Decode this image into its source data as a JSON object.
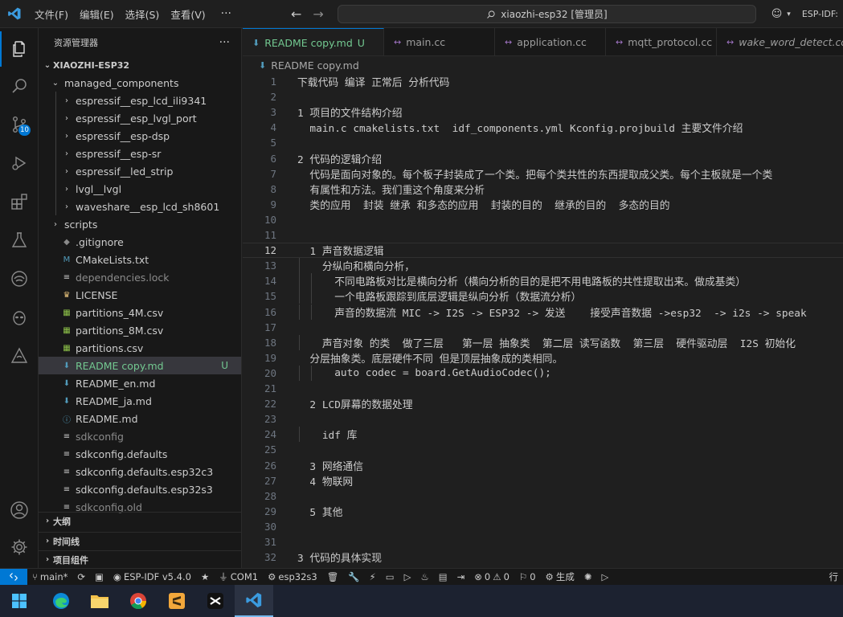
{
  "titlebar": {
    "menus": [
      "文件(F)",
      "编辑(E)",
      "选择(S)",
      "查看(V)"
    ],
    "more": "···",
    "search_text": "xiaozhi-esp32 [管理员]",
    "right_label": "ESP-IDF:"
  },
  "activity": {
    "source_control_badge": "10"
  },
  "sidebar": {
    "title": "资源管理器",
    "more": "···",
    "root": "XIAOZHI-ESP32",
    "tree": [
      {
        "label": "managed_components",
        "kind": "folder-open",
        "indent": 1
      },
      {
        "label": "espressif__esp_lcd_ili9341",
        "kind": "folder",
        "indent": 2
      },
      {
        "label": "espressif__esp_lvgl_port",
        "kind": "folder",
        "indent": 2
      },
      {
        "label": "espressif__esp-dsp",
        "kind": "folder",
        "indent": 2
      },
      {
        "label": "espressif__esp-sr",
        "kind": "folder",
        "indent": 2
      },
      {
        "label": "espressif__led_strip",
        "kind": "folder",
        "indent": 2
      },
      {
        "label": "lvgl__lvgl",
        "kind": "folder",
        "indent": 2
      },
      {
        "label": "waveshare__esp_lcd_sh8601",
        "kind": "folder",
        "indent": 2
      },
      {
        "label": "scripts",
        "kind": "folder",
        "indent": 1
      },
      {
        "label": ".gitignore",
        "kind": "git",
        "indent": 1
      },
      {
        "label": "CMakeLists.txt",
        "kind": "cmake",
        "indent": 1
      },
      {
        "label": "dependencies.lock",
        "kind": "lines",
        "indent": 1,
        "dim": true
      },
      {
        "label": "LICENSE",
        "kind": "license",
        "indent": 1
      },
      {
        "label": "partitions_4M.csv",
        "kind": "csv",
        "indent": 1
      },
      {
        "label": "partitions_8M.csv",
        "kind": "csv",
        "indent": 1
      },
      {
        "label": "partitions.csv",
        "kind": "csv",
        "indent": 1
      },
      {
        "label": "README copy.md",
        "kind": "md",
        "indent": 1,
        "selected": true,
        "status": "U"
      },
      {
        "label": "README_en.md",
        "kind": "md",
        "indent": 1
      },
      {
        "label": "README_ja.md",
        "kind": "md",
        "indent": 1
      },
      {
        "label": "README.md",
        "kind": "info",
        "indent": 1
      },
      {
        "label": "sdkconfig",
        "kind": "lines",
        "indent": 1,
        "dim": true
      },
      {
        "label": "sdkconfig.defaults",
        "kind": "lines",
        "indent": 1
      },
      {
        "label": "sdkconfig.defaults.esp32c3",
        "kind": "lines",
        "indent": 1
      },
      {
        "label": "sdkconfig.defaults.esp32s3",
        "kind": "lines",
        "indent": 1
      },
      {
        "label": "sdkconfig.old",
        "kind": "lines",
        "indent": 1,
        "dim": true
      }
    ],
    "sections": [
      "大纲",
      "时间线",
      "项目组件"
    ]
  },
  "tabs": [
    {
      "label": "README copy.md",
      "status": "U",
      "active": true,
      "icon": "md"
    },
    {
      "label": "main.cc",
      "icon": "c"
    },
    {
      "label": "application.cc",
      "icon": "c"
    },
    {
      "label": "mqtt_protocol.cc",
      "icon": "c"
    },
    {
      "label": "wake_word_detect.cc",
      "icon": "c",
      "italic": true
    }
  ],
  "breadcrumb": "README copy.md",
  "editor": {
    "current_line": 12,
    "lines": [
      {
        "n": "1",
        "text": "下载代码 编译 正常后 分析代码"
      },
      {
        "n": "2",
        "text": ""
      },
      {
        "n": "3",
        "text": "1 项目的文件结构介绍"
      },
      {
        "n": "4",
        "text": "  main.c cmakelists.txt  idf_components.yml Kconfig.projbuild 主要文件介绍"
      },
      {
        "n": "5",
        "text": ""
      },
      {
        "n": "6",
        "text": "2 代码的逻辑介绍"
      },
      {
        "n": "7",
        "text": "  代码是面向对象的。每个板子封装成了一个类。把每个类共性的东西提取成父类。每个主板就是一个类"
      },
      {
        "n": "8",
        "text": "  有属性和方法。我们重这个角度来分析"
      },
      {
        "n": "9",
        "text": "  类的应用  封装 继承 和多态的应用  封装的目的  继承的目的  多态的目的"
      },
      {
        "n": "10",
        "text": ""
      },
      {
        "n": "11",
        "text": ""
      },
      {
        "n": "12",
        "text": "  1 声音数据逻辑"
      },
      {
        "n": "13",
        "text": "    分纵向和横向分析，"
      },
      {
        "n": "14",
        "text": "      不同电路板对比是横向分析（横向分析的目的是把不用电路板的共性提取出来。做成基类）"
      },
      {
        "n": "15",
        "text": "      一个电路板跟踪到底层逻辑是纵向分析（数据流分析）"
      },
      {
        "n": "16",
        "text": "      声音的数据流 MIC -> I2S -> ESP32 -> 发送    接受声音数据 ->esp32  -> i2s -> speak"
      },
      {
        "n": "17",
        "text": ""
      },
      {
        "n": "18",
        "text": "    声音对象 的类  做了三层   第一层 抽象类  第二层 读写函数  第三层  硬件驱动层  I2S 初始化"
      },
      {
        "n": "19",
        "text": "  分层抽象类。底层硬件不同 但是顶层抽象成的类相同。"
      },
      {
        "n": "20",
        "text": "      auto codec = board.GetAudioCodec();"
      },
      {
        "n": "21",
        "text": ""
      },
      {
        "n": "22",
        "text": "  2 LCD屏幕的数据处理"
      },
      {
        "n": "23",
        "text": ""
      },
      {
        "n": "24",
        "text": "    idf 库"
      },
      {
        "n": "25",
        "text": ""
      },
      {
        "n": "26",
        "text": "  3 网络通信"
      },
      {
        "n": "27",
        "text": "  4 物联网"
      },
      {
        "n": "28",
        "text": ""
      },
      {
        "n": "29",
        "text": "  5 其他"
      },
      {
        "n": "30",
        "text": ""
      },
      {
        "n": "31",
        "text": ""
      },
      {
        "n": "32",
        "text": "3 代码的具体实现"
      }
    ]
  },
  "statusbar": {
    "branch": "main*",
    "idf": "ESP-IDF v5.4.0",
    "com": "COM1",
    "target": "esp32s3",
    "errors": "0",
    "warnings": "0",
    "infos": "0",
    "build": "生成",
    "right": "行"
  },
  "colors": {
    "accent": "#0078d4",
    "modified": "#73c991"
  }
}
